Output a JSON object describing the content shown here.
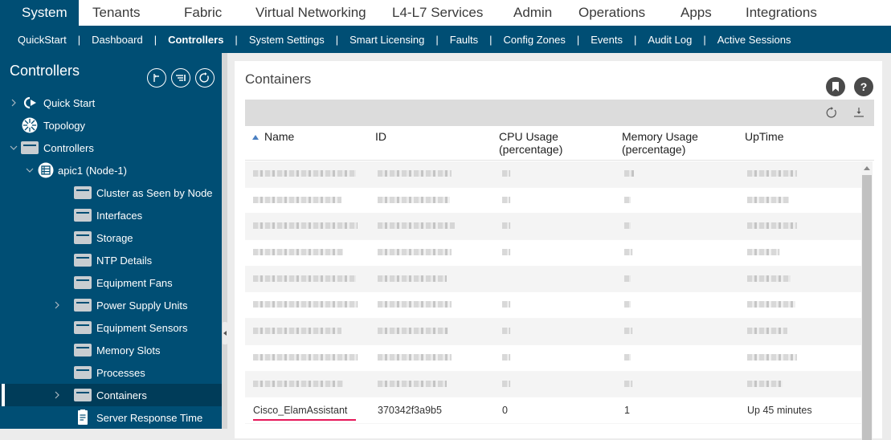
{
  "top_nav": {
    "tabs": [
      "System",
      "Tenants",
      "Fabric",
      "Virtual Networking",
      "L4-L7 Services",
      "Admin",
      "Operations",
      "Apps",
      "Integrations"
    ],
    "active": "System"
  },
  "sub_nav": {
    "items": [
      "QuickStart",
      "Dashboard",
      "Controllers",
      "System Settings",
      "Smart Licensing",
      "Faults",
      "Config Zones",
      "Events",
      "Audit Log",
      "Active Sessions"
    ],
    "active": "Controllers"
  },
  "sidebar": {
    "title": "Controllers",
    "buttons": [
      "collapse-icon",
      "filter-list-icon",
      "refresh-icon"
    ],
    "tree": [
      {
        "label": "Quick Start",
        "icon": "quickstart-icon",
        "level": 0,
        "chevron": "right"
      },
      {
        "label": "Topology",
        "icon": "topology-icon",
        "level": 0,
        "chevron": null
      },
      {
        "label": "Controllers",
        "icon": "folder-icon",
        "level": 0,
        "chevron": "down"
      },
      {
        "label": "apic1 (Node-1)",
        "icon": "server-icon",
        "level": 1,
        "chevron": "down"
      },
      {
        "label": "Cluster as Seen by Node",
        "icon": "folder-icon",
        "level": 2,
        "chevron": null
      },
      {
        "label": "Interfaces",
        "icon": "folder-icon",
        "level": 2,
        "chevron": null
      },
      {
        "label": "Storage",
        "icon": "folder-icon",
        "level": 2,
        "chevron": null
      },
      {
        "label": "NTP Details",
        "icon": "folder-icon",
        "level": 2,
        "chevron": null
      },
      {
        "label": "Equipment Fans",
        "icon": "folder-icon",
        "level": 2,
        "chevron": null
      },
      {
        "label": "Power Supply Units",
        "icon": "folder-icon",
        "level": 2,
        "chevron": "right"
      },
      {
        "label": "Equipment Sensors",
        "icon": "folder-icon",
        "level": 2,
        "chevron": null
      },
      {
        "label": "Memory Slots",
        "icon": "folder-icon",
        "level": 2,
        "chevron": null
      },
      {
        "label": "Processes",
        "icon": "folder-icon",
        "level": 2,
        "chevron": null
      },
      {
        "label": "Containers",
        "icon": "folder-icon",
        "level": 2,
        "chevron": "right",
        "selected": true
      },
      {
        "label": "Server Response Time",
        "icon": "document-icon",
        "level": 2,
        "chevron": null
      }
    ]
  },
  "panel": {
    "title": "Containers",
    "header_buttons": [
      "bookmark-icon",
      "help-icon"
    ],
    "help_glyph": "?",
    "toolbar_icons": [
      "refresh-icon",
      "download-icon"
    ],
    "columns": [
      "Name",
      "ID",
      "CPU Usage\n(percentage)",
      "Memory Usage\n(percentage)",
      "UpTime"
    ],
    "column_lines": [
      [
        "Name"
      ],
      [
        "ID"
      ],
      [
        "CPU Usage",
        "(percentage)"
      ],
      [
        "Memory Usage",
        "(percentage)"
      ],
      [
        "UpTime"
      ]
    ],
    "sort": {
      "column": "Name",
      "direction": "ascending"
    },
    "obscured_rows": 9,
    "highlighted_row": {
      "name": "Cisco_ElamAssistant",
      "id": "370342f3a9b5",
      "cpu": "0",
      "memory": "1",
      "uptime": "Up 45 minutes"
    },
    "highlight_color": "#e6185a"
  },
  "colors": {
    "brand": "#004e74",
    "selected_node": "#003c59",
    "sort_arrow": "#4a7fc1"
  }
}
